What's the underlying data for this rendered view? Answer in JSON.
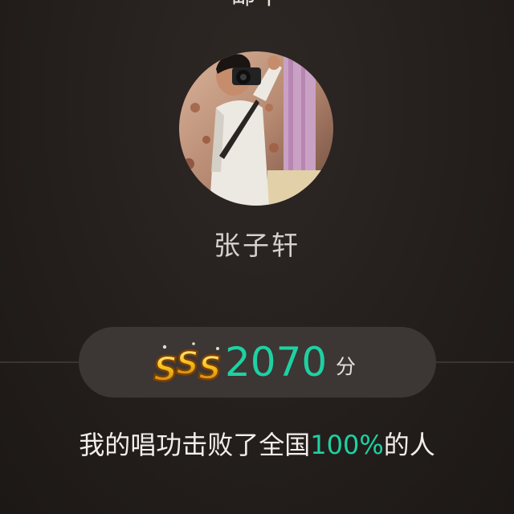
{
  "header": {
    "song_title": "邮中"
  },
  "profile": {
    "avatar_description": "user-avatar-photo",
    "username": "张子轩"
  },
  "score": {
    "grade": "SSS",
    "value": "2070",
    "unit": "分",
    "value_color": "#1ed1a2"
  },
  "rank": {
    "prefix": "我的唱功击败了全国",
    "percent": "100%",
    "suffix": "的人"
  }
}
